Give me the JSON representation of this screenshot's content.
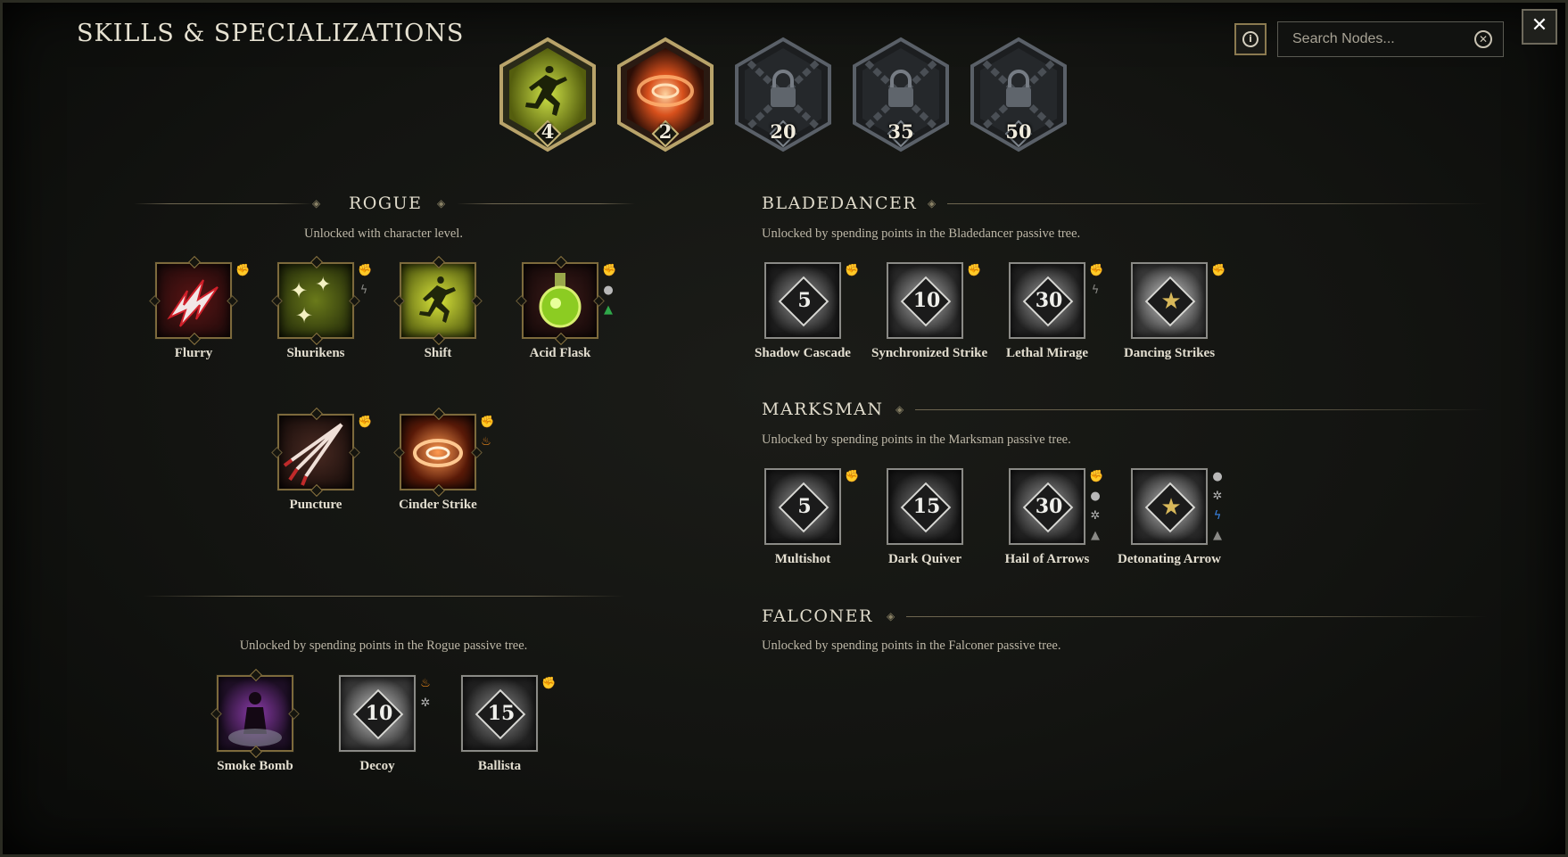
{
  "title": "SKILLS & SPECIALIZATIONS",
  "specializations": [
    {
      "type": "unlocked",
      "icon": "shift-runner-icon",
      "value": "4",
      "color": "#c6d428"
    },
    {
      "type": "unlocked",
      "icon": "cinder-swirl-icon",
      "value": "2",
      "color": "#e8682a"
    },
    {
      "type": "locked",
      "icon": "padlock-chain-icon",
      "value": "20"
    },
    {
      "type": "locked",
      "icon": "padlock-chain-icon",
      "value": "35"
    },
    {
      "type": "locked",
      "icon": "padlock-chain-icon",
      "value": "50"
    }
  ],
  "search": {
    "placeholder": "Search Nodes..."
  },
  "rogue": {
    "title": "ROGUE",
    "subtitle": "Unlocked with character level.",
    "row1": [
      {
        "label": "Flurry",
        "tags": [
          "phys"
        ]
      },
      {
        "label": "Shurikens",
        "tags": [
          "phys",
          "light-gray"
        ]
      },
      {
        "label": "Shift",
        "tags": []
      },
      {
        "label": "Acid Flask",
        "tags": [
          "phys",
          "cold",
          "poison"
        ]
      }
    ],
    "row2": [
      {
        "label": "Puncture",
        "tags": [
          "phys"
        ]
      },
      {
        "label": "Cinder Strike",
        "tags": [
          "phys",
          "fire"
        ]
      }
    ],
    "passive_subtitle": "Unlocked by spending points in the Rogue passive tree.",
    "row3": [
      {
        "label": "Smoke Bomb",
        "tags": []
      },
      {
        "label": "Decoy",
        "level": "10",
        "tags": [
          "fire",
          "cold"
        ]
      },
      {
        "label": "Ballista",
        "level": "15",
        "tags": [
          "phys"
        ]
      }
    ]
  },
  "bladedancer": {
    "title": "BLADEDANCER",
    "subtitle": "Unlocked by spending points in the Bladedancer passive tree.",
    "skills": [
      {
        "label": "Shadow Cascade",
        "level": "5"
      },
      {
        "label": "Synchronized Strike",
        "level": "10"
      },
      {
        "label": "Lethal Mirage",
        "level": "30"
      },
      {
        "label": "Dancing Strikes",
        "level": "star"
      }
    ]
  },
  "marksman": {
    "title": "MARKSMAN",
    "subtitle": "Unlocked by spending points in the Marksman passive tree.",
    "skills": [
      {
        "label": "Multishot",
        "level": "5"
      },
      {
        "label": "Dark Quiver",
        "level": "15"
      },
      {
        "label": "Hail of Arrows",
        "level": "30"
      },
      {
        "label": "Detonating Arrow",
        "level": "star"
      }
    ]
  },
  "falconer": {
    "title": "FALCONER",
    "subtitle": "Unlocked by spending points in the Falconer passive tree."
  }
}
